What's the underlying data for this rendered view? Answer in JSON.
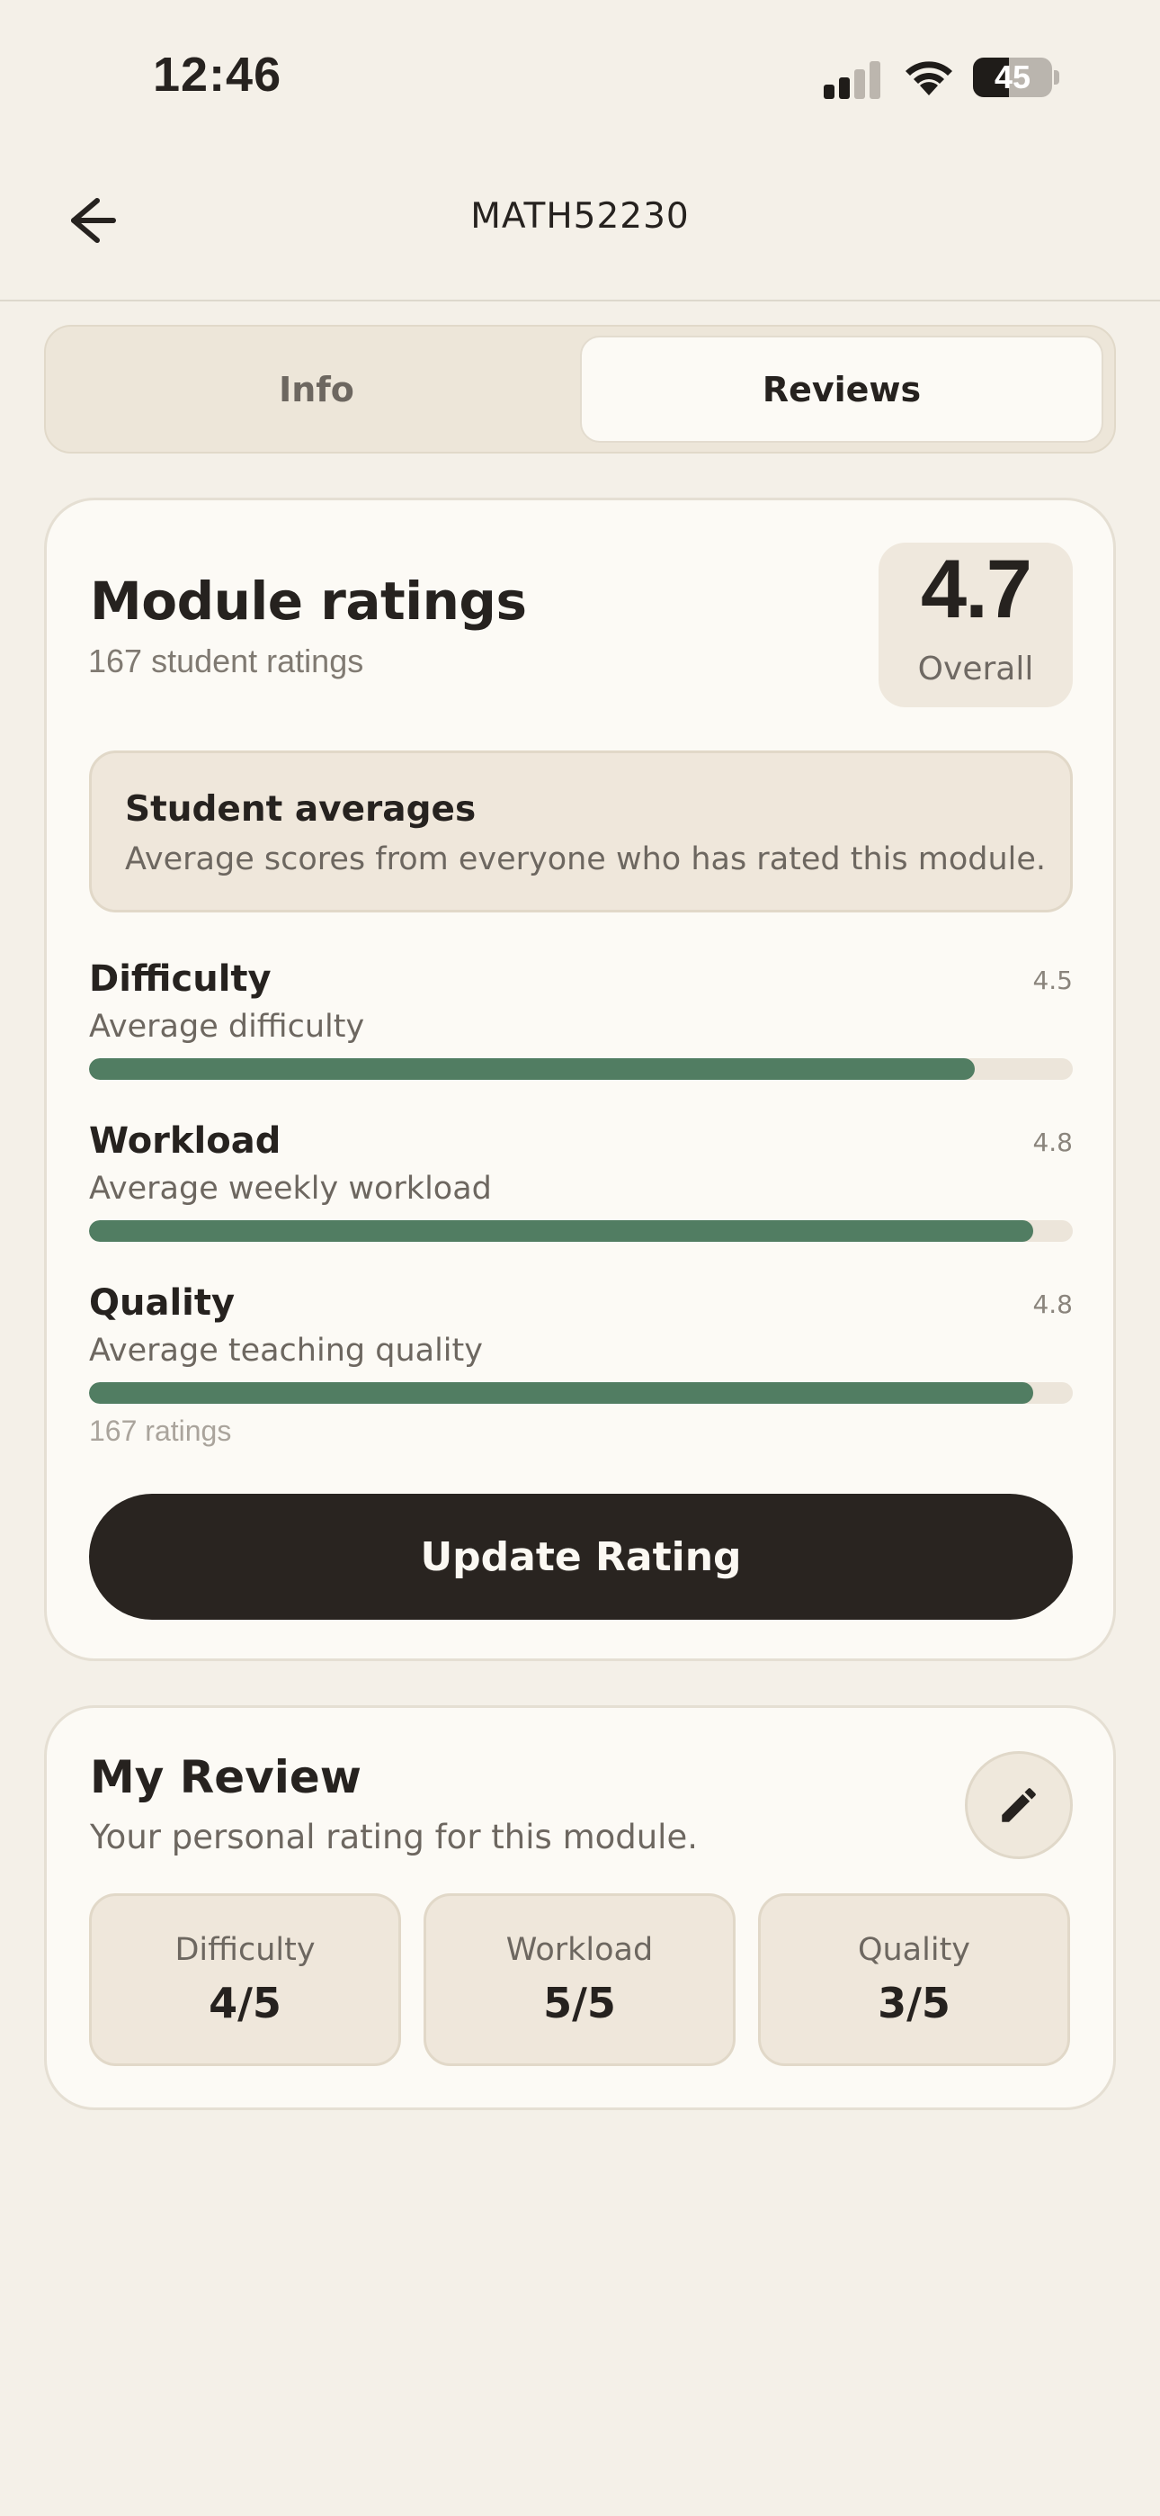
{
  "status_bar": {
    "time": "12:46",
    "battery": "45",
    "battery_level_percent": 45,
    "signal_bars_active": 2,
    "signal_bars_total": 4
  },
  "header": {
    "title": "MATH52230",
    "back_icon": "arrow-left-icon"
  },
  "tabs": [
    {
      "label": "Info",
      "selected": false
    },
    {
      "label": "Reviews",
      "selected": true
    }
  ],
  "ratings": {
    "title": "Module ratings",
    "subtitle": "167 student ratings",
    "overall_value": "4.7",
    "overall_label": "Overall",
    "averages_title": "Student averages",
    "averages_desc": "Average scores from everyone who has rated this module.",
    "metrics": [
      {
        "label": "Difficulty",
        "desc": "Average difficulty",
        "value": "4.5",
        "fraction": 0.9
      },
      {
        "label": "Workload",
        "desc": "Average weekly workload",
        "value": "4.8",
        "fraction": 0.96
      },
      {
        "label": "Quality",
        "desc": "Average teaching quality",
        "value": "4.8",
        "fraction": 0.96
      }
    ],
    "count_note": "167 ratings",
    "update_button": "Update Rating"
  },
  "my_review": {
    "title": "My Review",
    "subtitle": "Your personal rating for this module.",
    "edit_icon": "pencil-icon",
    "scores": [
      {
        "label": "Difficulty",
        "value": "4/5"
      },
      {
        "label": "Workload",
        "value": "5/5"
      },
      {
        "label": "Quality",
        "value": "3/5"
      }
    ]
  },
  "colors": {
    "background": "#f4f0e8",
    "card": "#fcfaf5",
    "accent_green": "#517d62",
    "button_dark": "#292420"
  }
}
